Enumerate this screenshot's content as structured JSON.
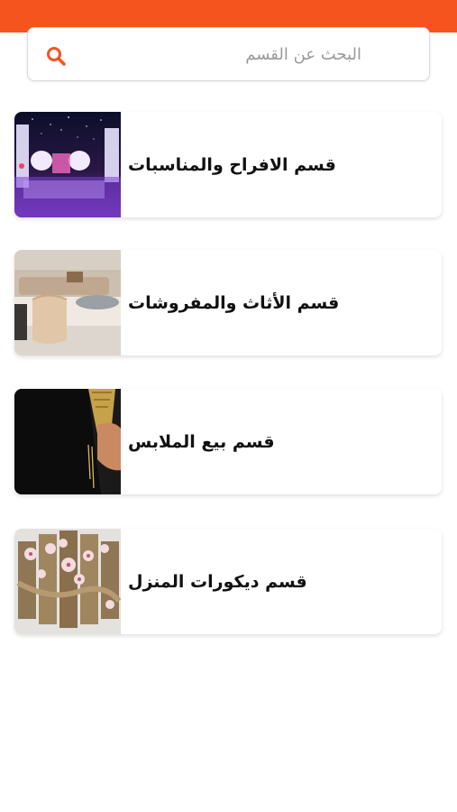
{
  "header": {
    "accent_color": "#f5541f"
  },
  "search": {
    "placeholder": "البحث عن القسم",
    "value": "",
    "icon": "search-icon"
  },
  "categories": [
    {
      "label": "قسم الافراح والمناسبات",
      "image": "event-stage-photo"
    },
    {
      "label": "قسم الأثاث والمفروشات",
      "image": "living-room-furniture-photo"
    },
    {
      "label": "قسم بيع الملابس",
      "image": "dark-robe-photo"
    },
    {
      "label": "قسم ديكورات المنزل",
      "image": "floral-wall-art-photo"
    }
  ]
}
